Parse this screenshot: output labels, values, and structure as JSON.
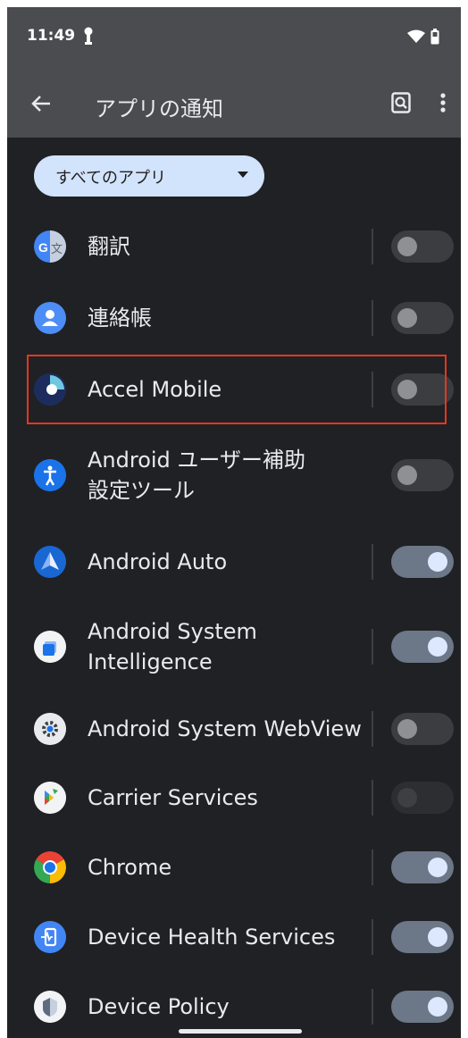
{
  "status": {
    "time": "11:49"
  },
  "appbar": {
    "title": "アプリの通知"
  },
  "filter": {
    "selected": "すべてのアプリ"
  },
  "apps": [
    {
      "label": "翻訳",
      "toggle": "off"
    },
    {
      "label": "連絡帳",
      "toggle": "off"
    },
    {
      "label": "Accel Mobile",
      "toggle": "off",
      "highlighted": true
    },
    {
      "label": "Android ユーザー補助\n設定ツール",
      "toggle": "off"
    },
    {
      "label": "Android Auto",
      "toggle": "on"
    },
    {
      "label": "Android System\nIntelligence",
      "toggle": "on"
    },
    {
      "label": "Android System WebView",
      "toggle": "off"
    },
    {
      "label": "Carrier Services",
      "toggle": "disabled"
    },
    {
      "label": "Chrome",
      "toggle": "on"
    },
    {
      "label": "Device Health Services",
      "toggle": "on"
    },
    {
      "label": "Device Policy",
      "toggle": "on"
    }
  ],
  "colors": {
    "background": "#202124",
    "appbar": "#4b4c4f",
    "chip": "#d2e3fc",
    "highlight": "#e5371f",
    "toggle_on": "#6c7788"
  }
}
